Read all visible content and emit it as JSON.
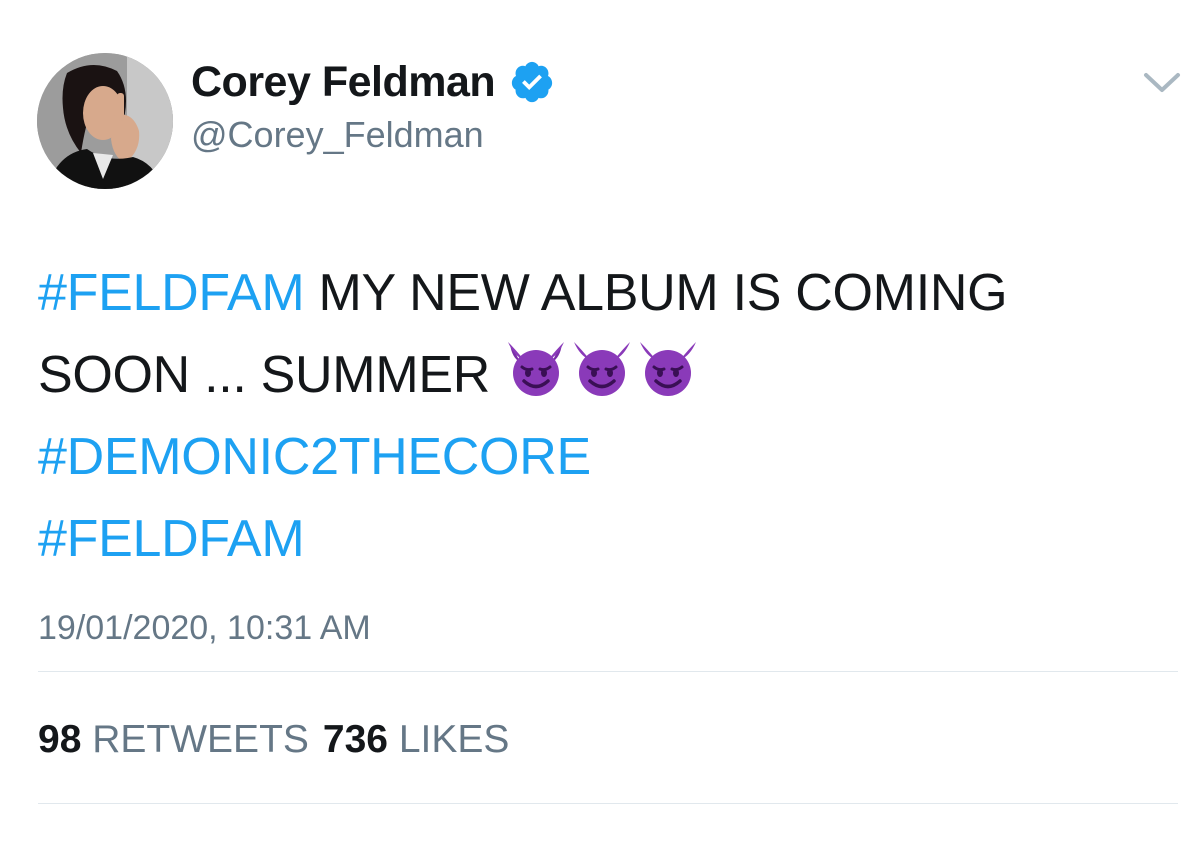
{
  "author": {
    "display_name": "Corey Feldman",
    "handle": "@Corey_Feldman",
    "verified": true,
    "avatar_icon": "profile-photo"
  },
  "tweet": {
    "lines": [
      {
        "hashtag": "#FELDFAM",
        "text": " MY NEW ALBUM IS COMING"
      },
      {
        "text": "SOON ... SUMMER ",
        "emojis": [
          "smiling-imp",
          "smiling-imp",
          "smiling-imp"
        ]
      },
      {
        "hashtag": "#DEMONIC2THECORE"
      },
      {
        "hashtag": "#FELDFAM"
      }
    ],
    "timestamp": "19/01/2020, 10:31 AM"
  },
  "stats": {
    "retweets_count": "98",
    "retweets_label": "RETWEETS",
    "likes_count": "736",
    "likes_label": "LIKES"
  },
  "colors": {
    "hashtag": "#1da1f2",
    "secondary_text": "#657786",
    "primary_text": "#14171a",
    "verified_badge": "#1da1f2",
    "emoji_purple": "#8a3ab9"
  },
  "icons": {
    "verified": "verified-badge-icon",
    "caret": "chevron-down-icon",
    "emoji": "smiling-imp-emoji-icon"
  }
}
